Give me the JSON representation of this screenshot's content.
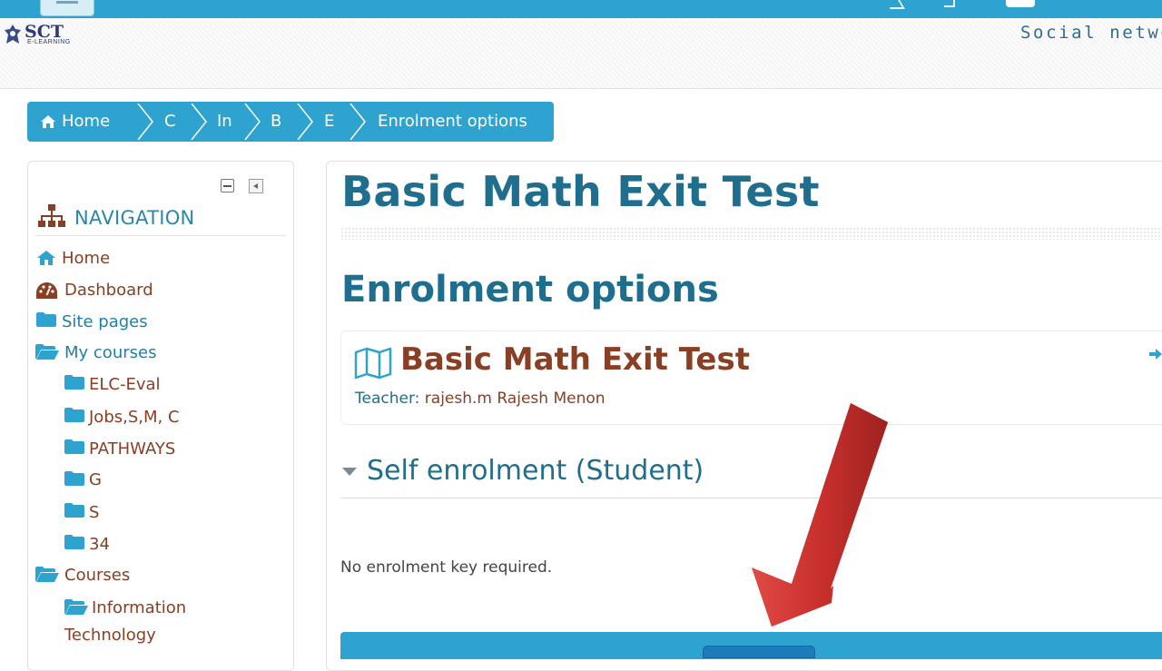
{
  "header": {
    "logo_text": "SCT",
    "logo_sub": "E-LEARNING",
    "tagline": "Social netwo"
  },
  "breadcrumb": {
    "items": [
      "Home",
      "C",
      "In",
      "B",
      "E",
      "Enrolment options"
    ]
  },
  "navigation": {
    "title": "NAVIGATION",
    "items": [
      {
        "label": "Home"
      },
      {
        "label": "Dashboard"
      },
      {
        "label": "Site pages"
      },
      {
        "label": "My courses"
      },
      {
        "label": "ELC-Eval"
      },
      {
        "label": "Jobs,S,M, C"
      },
      {
        "label": "PATHWAYS"
      },
      {
        "label": "G"
      },
      {
        "label": "S"
      },
      {
        "label": "34"
      },
      {
        "label": "Courses"
      },
      {
        "label": "Information"
      },
      {
        "label": "Technology"
      }
    ]
  },
  "main": {
    "course_title": "Basic Math Exit Test",
    "enrolment_heading": "Enrolment options",
    "course_box": {
      "title": "Basic Math Exit Test",
      "teacher_label": "Teacher:",
      "teacher_name": "rajesh.m Rajesh Menon"
    },
    "self_enrolment": {
      "title": "Self enrolment (Student)",
      "no_key_text": "No enrolment key required."
    }
  },
  "colors": {
    "accent": "#2ea3cf",
    "heading": "#1f6e8e",
    "link": "#8a3e23",
    "arrow": "#c9302c"
  }
}
